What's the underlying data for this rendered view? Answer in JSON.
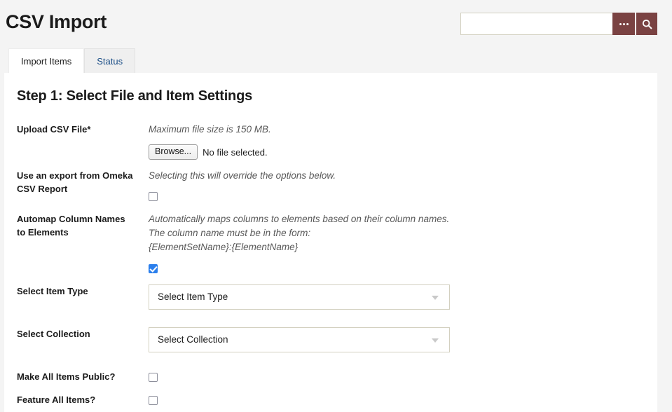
{
  "header": {
    "title": "CSV Import",
    "search": {
      "value": "",
      "placeholder": "",
      "advanced_icon": "ellipsis-icon",
      "submit_icon": "search-icon"
    }
  },
  "tabs": [
    {
      "label": "Import Items",
      "active": true
    },
    {
      "label": "Status",
      "active": false
    }
  ],
  "main": {
    "step_title": "Step 1: Select File and Item Settings",
    "fields": {
      "upload": {
        "label": "Upload CSV File*",
        "hint": "Maximum file size is 150 MB.",
        "browse_label": "Browse...",
        "file_status": "No file selected."
      },
      "omeka_export": {
        "label": "Use an export from Omeka CSV Report",
        "hint": "Selecting this will override the options below.",
        "checked": false
      },
      "automap": {
        "label": "Automap Column Names to Elements",
        "hint_line1": "Automatically maps columns to elements based on their column names.",
        "hint_line2": "The column name must be in the form:",
        "hint_line3": "{ElementSetName}:{ElementName}",
        "checked": true
      },
      "item_type": {
        "label": "Select Item Type",
        "selected": "Select Item Type"
      },
      "collection": {
        "label": "Select Collection",
        "selected": "Select Collection"
      },
      "public": {
        "label": "Make All Items Public?",
        "checked": false
      },
      "featured": {
        "label": "Feature All Items?",
        "checked": false
      }
    }
  },
  "colors": {
    "accent": "#7a4242",
    "link": "#1b4e87",
    "checkbox_checked": "#2b7fec",
    "page_bg": "#f4f4f4",
    "border": "#d3d0c0"
  }
}
